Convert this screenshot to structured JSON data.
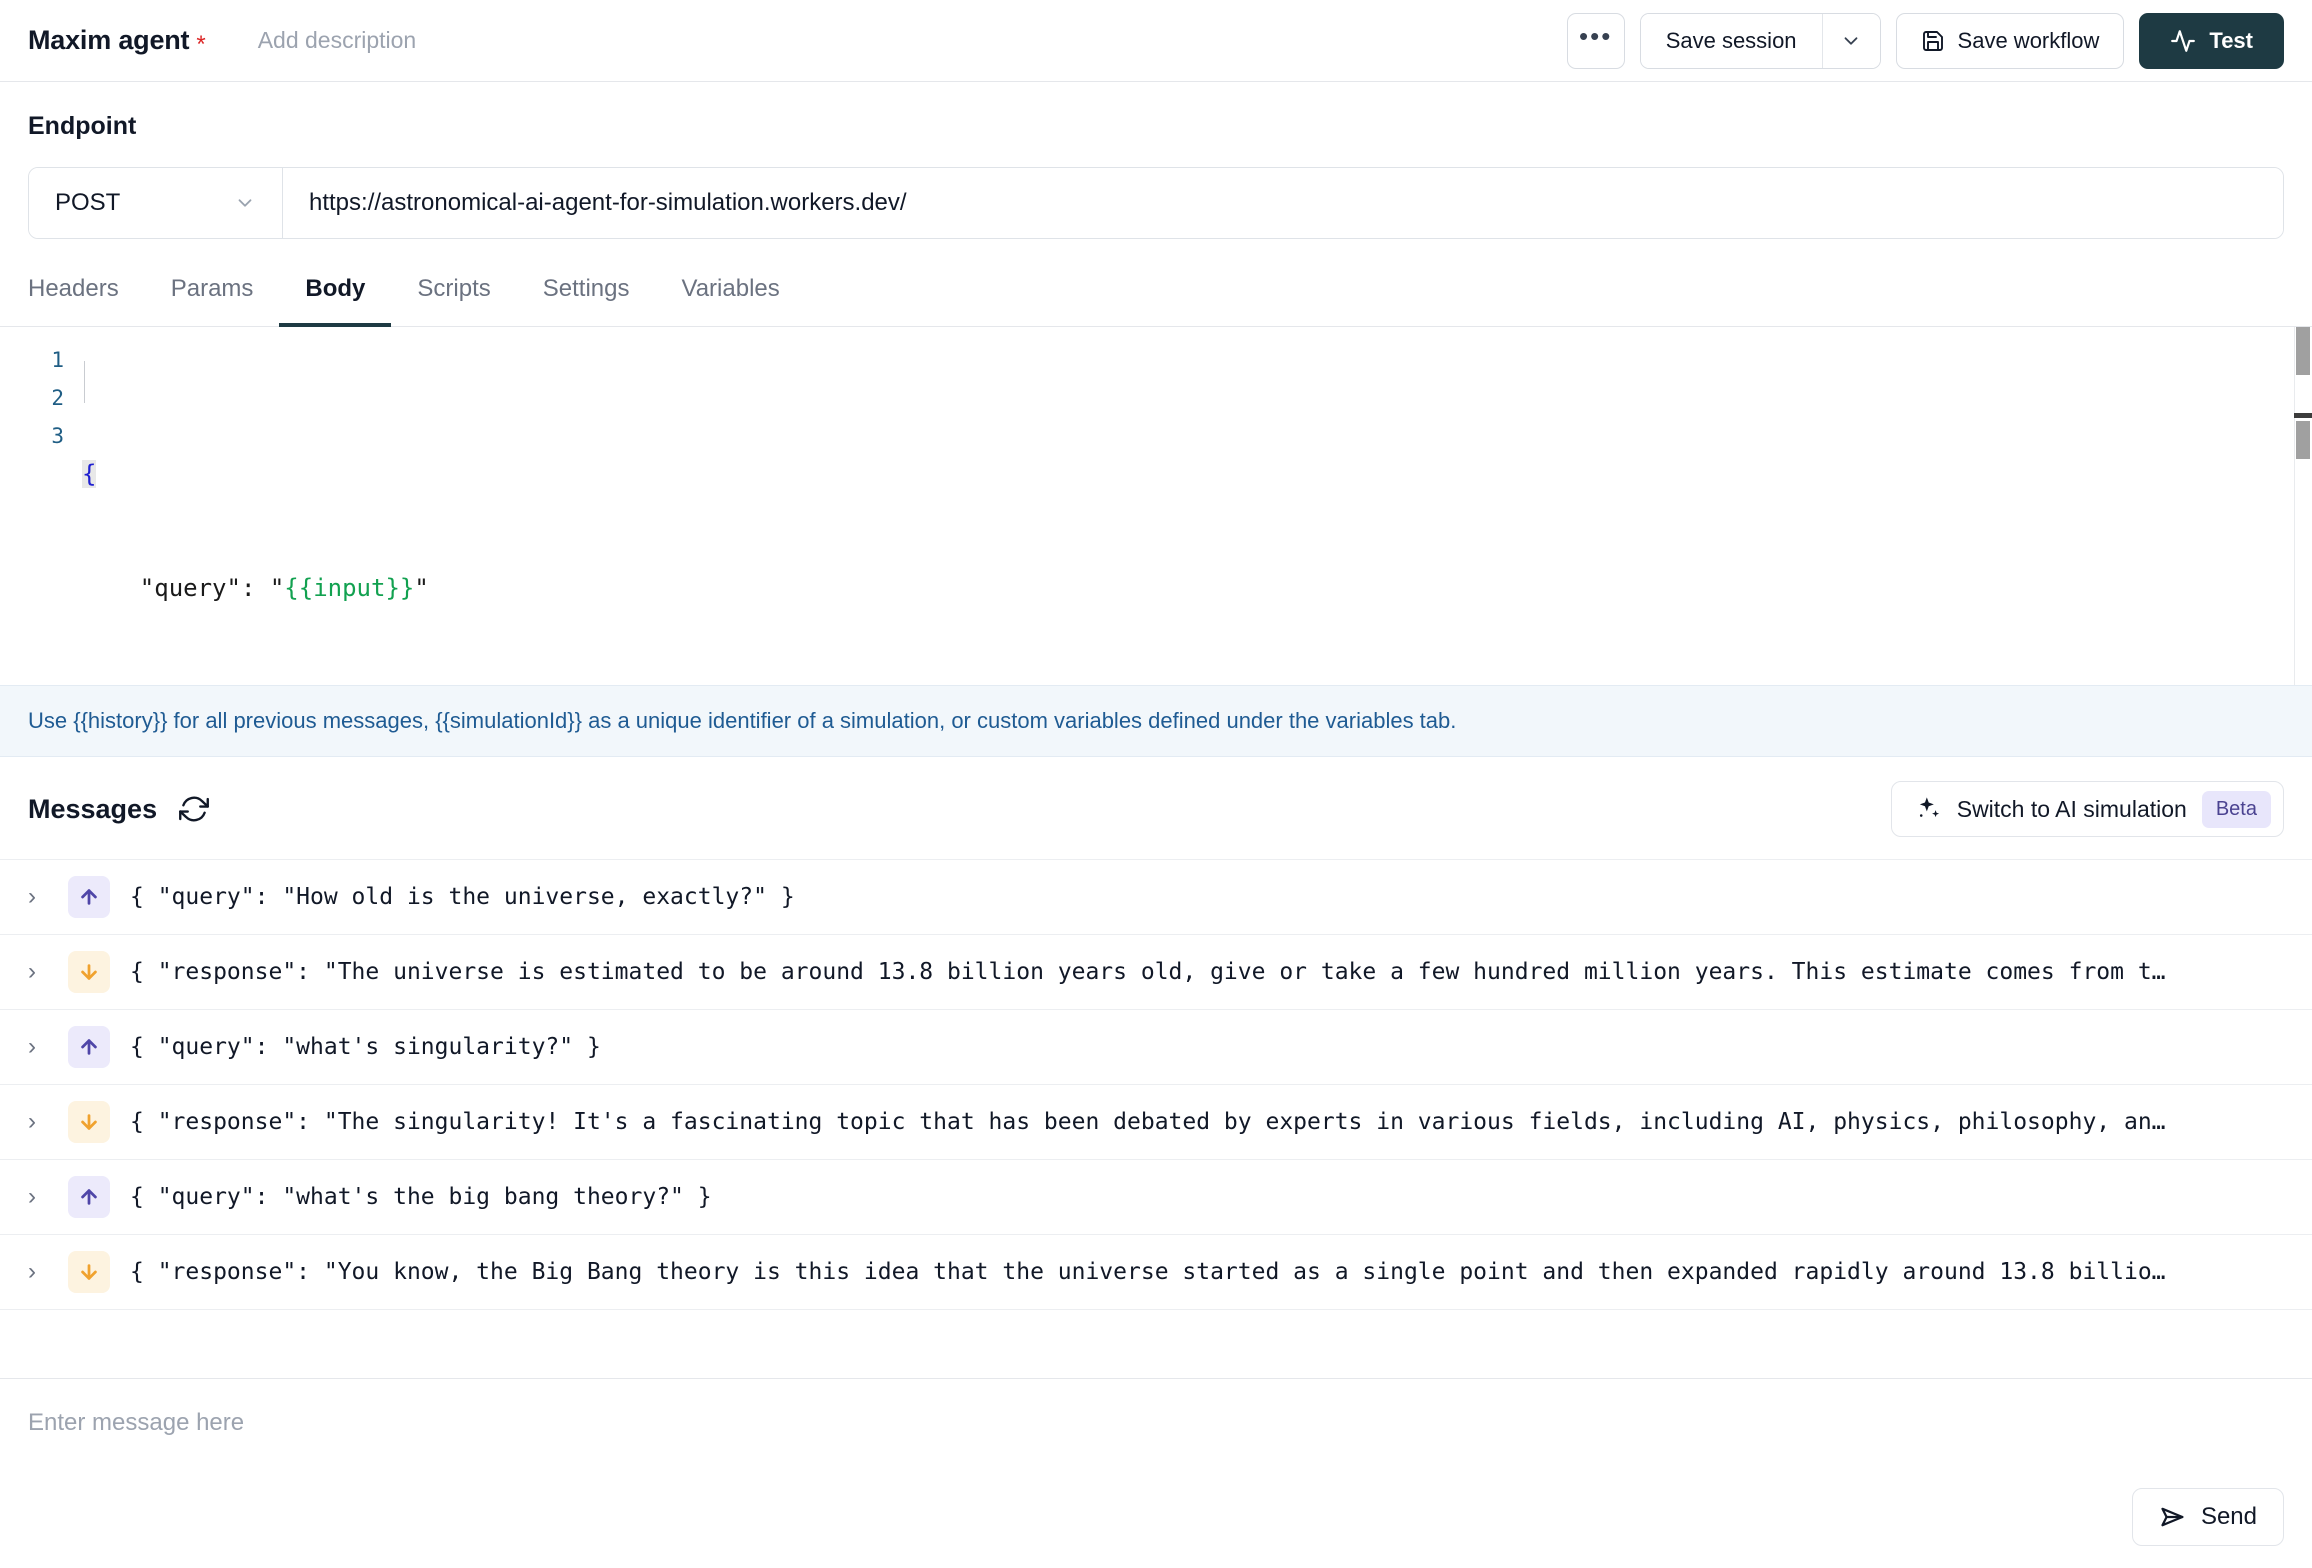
{
  "header": {
    "title": "Maxim agent",
    "required_marker": "*",
    "description_placeholder": "Add description",
    "more_label": "•••",
    "save_session_label": "Save session",
    "save_workflow_label": "Save workflow",
    "test_label": "Test"
  },
  "endpoint": {
    "section_title": "Endpoint",
    "method": "POST",
    "url": "https://astronomical-ai-agent-for-simulation.workers.dev/",
    "tabs": [
      {
        "label": "Headers",
        "active": false
      },
      {
        "label": "Params",
        "active": false
      },
      {
        "label": "Body",
        "active": true
      },
      {
        "label": "Scripts",
        "active": false
      },
      {
        "label": "Settings",
        "active": false
      },
      {
        "label": "Variables",
        "active": false
      }
    ]
  },
  "editor": {
    "line_numbers": [
      "1",
      "2",
      "3"
    ],
    "line1_brace": "{",
    "line2_key": "    \"query\": \"",
    "line2_var": "{{input}}",
    "line2_end": "\"",
    "line3_brace": "}"
  },
  "info_bar": {
    "text": "Use {{history}} for all previous messages, {{simulationId}} as a unique identifier of a simulation, or custom variables defined under the variables tab."
  },
  "messages_panel": {
    "title": "Messages",
    "ai_sim_label": "Switch to AI simulation",
    "beta_label": "Beta",
    "rows": [
      {
        "direction": "up",
        "text": "{ \"query\": \"How old is the universe, exactly?\" }",
        "chevron": "›"
      },
      {
        "direction": "down",
        "text": "{ \"response\": \"The universe is estimated to be around 13.8 billion years old, give or take a few hundred million years. This estimate comes from t…",
        "chevron": "›"
      },
      {
        "direction": "up",
        "text": "{ \"query\": \"what's singularity?\" }",
        "chevron": "›"
      },
      {
        "direction": "down",
        "text": "{ \"response\": \"The singularity! It's a fascinating topic that has been debated by experts in various fields, including AI, physics, philosophy, an…",
        "chevron": "›"
      },
      {
        "direction": "up",
        "text": "{ \"query\": \"what's the big bang theory?\" }",
        "chevron": "›"
      },
      {
        "direction": "down",
        "text": "{ \"response\": \"You know, the Big Bang theory is this idea that the universe started as a single point and then expanded rapidly around 13.8 billio…",
        "chevron": "›"
      }
    ]
  },
  "composer": {
    "placeholder": "Enter message here",
    "value": "",
    "send_label": "Send"
  },
  "colors": {
    "accent_dark": "#1e3a43",
    "required_red": "#dc2626",
    "info_blue": "#1f5b93",
    "info_bg": "#f2f7fb",
    "up_arrow": "#4f46a8",
    "down_arrow": "#f0a22e",
    "beta_badge_bg": "#e8e6fb"
  }
}
